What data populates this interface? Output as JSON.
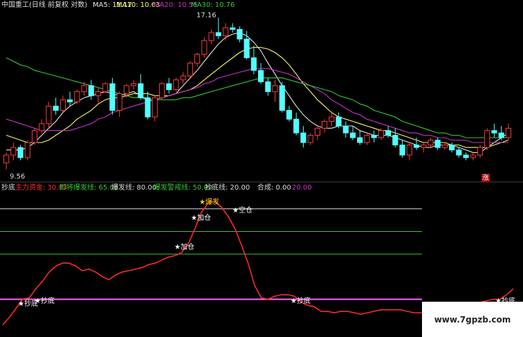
{
  "header": {
    "title": "中国重工(日线 前复权 对数)",
    "ma5": "MA5: 11.17",
    "ma10": "MA10: 10.63",
    "ma20": "MA20: 10.55",
    "ma30": "MA30: 10.76"
  },
  "price_labels": {
    "high": "17.16",
    "low": "9.56",
    "zhang": "涨"
  },
  "sub_header": {
    "name": "抄底",
    "fund": "主力资金: 30.83",
    "about": "即将爆发线: 65.00",
    "burst": "爆发线: 80.00",
    "warn": "爆发警戒线: 50.00",
    "bottom": "抄底线: 20.00",
    "combo": "合成: 0.00",
    "combo_val": "20.00"
  },
  "markers": {
    "bao_fa": "★爆发",
    "kong_cang": "★空仓",
    "jia_cang": "★加仓",
    "chao_di": "★抄底"
  },
  "watermark": "www.7gpzb.com",
  "colors": {
    "up": "#ff3b3b",
    "down": "#54ffff",
    "ma5": "#e8e8e8",
    "ma10": "#ffff66",
    "ma20": "#cc33cc",
    "ma30": "#33cc33",
    "fund_line": "#ff2a2a",
    "level_white": "#dddddd",
    "level_green": "#33cc33",
    "level_purple": "#ff66ff"
  },
  "chart_data": [
    {
      "type": "candlestick",
      "title": "中国重工(日线 前复权 对数)",
      "ylim": [
        9.3,
        17.6
      ],
      "ohlc": [
        [
          9.8,
          10.2,
          9.56,
          10.1
        ],
        [
          10.1,
          10.6,
          9.9,
          10.4
        ],
        [
          10.4,
          10.5,
          9.9,
          10.0
        ],
        [
          10.0,
          10.7,
          9.9,
          10.6
        ],
        [
          10.6,
          11.2,
          10.5,
          11.1
        ],
        [
          11.1,
          11.6,
          11.0,
          11.4
        ],
        [
          11.4,
          12.4,
          11.2,
          12.2
        ],
        [
          12.2,
          12.6,
          11.8,
          12.0
        ],
        [
          12.0,
          12.7,
          11.9,
          12.5
        ],
        [
          12.5,
          12.9,
          12.2,
          12.4
        ],
        [
          12.4,
          13.0,
          12.3,
          12.9
        ],
        [
          12.9,
          13.4,
          12.7,
          13.2
        ],
        [
          13.2,
          13.5,
          12.5,
          12.7
        ],
        [
          12.7,
          13.1,
          12.3,
          12.9
        ],
        [
          12.9,
          13.4,
          12.8,
          13.3
        ],
        [
          13.3,
          13.6,
          11.8,
          12.0
        ],
        [
          12.0,
          12.9,
          11.7,
          12.8
        ],
        [
          12.8,
          13.3,
          12.6,
          13.2
        ],
        [
          13.2,
          13.5,
          13.0,
          13.3
        ],
        [
          13.3,
          13.8,
          12.5,
          12.6
        ],
        [
          12.6,
          12.9,
          11.6,
          11.7
        ],
        [
          11.7,
          12.7,
          11.5,
          12.6
        ],
        [
          12.6,
          13.4,
          12.5,
          13.3
        ],
        [
          13.3,
          13.6,
          12.8,
          13.0
        ],
        [
          13.0,
          13.6,
          12.9,
          13.5
        ],
        [
          13.5,
          13.9,
          13.3,
          13.7
        ],
        [
          13.7,
          14.5,
          13.6,
          14.4
        ],
        [
          14.4,
          15.0,
          14.2,
          14.9
        ],
        [
          14.9,
          15.9,
          14.7,
          15.7
        ],
        [
          15.7,
          16.4,
          15.5,
          16.2
        ],
        [
          16.2,
          17.16,
          15.8,
          16.0
        ],
        [
          16.0,
          16.8,
          15.7,
          16.5
        ],
        [
          16.5,
          16.8,
          16.2,
          16.4
        ],
        [
          16.4,
          16.6,
          15.6,
          15.8
        ],
        [
          15.8,
          16.3,
          14.6,
          14.7
        ],
        [
          14.7,
          15.4,
          13.8,
          14.0
        ],
        [
          14.0,
          14.4,
          13.3,
          13.4
        ],
        [
          13.4,
          13.6,
          12.7,
          12.9
        ],
        [
          12.9,
          13.5,
          12.4,
          13.2
        ],
        [
          13.2,
          13.4,
          11.9,
          12.0
        ],
        [
          12.0,
          12.2,
          11.5,
          11.6
        ],
        [
          11.6,
          11.9,
          10.9,
          11.0
        ],
        [
          11.0,
          11.3,
          10.4,
          10.6
        ],
        [
          10.6,
          11.0,
          10.5,
          10.9
        ],
        [
          10.9,
          11.3,
          10.7,
          11.2
        ],
        [
          11.2,
          11.6,
          11.0,
          11.5
        ],
        [
          11.5,
          11.9,
          11.3,
          11.7
        ],
        [
          11.7,
          11.9,
          11.2,
          11.3
        ],
        [
          11.3,
          11.5,
          10.8,
          11.0
        ],
        [
          11.0,
          11.3,
          10.7,
          10.8
        ],
        [
          10.8,
          11.1,
          10.5,
          10.6
        ],
        [
          10.6,
          11.0,
          10.5,
          10.9
        ],
        [
          10.9,
          11.1,
          10.6,
          10.8
        ],
        [
          10.8,
          11.2,
          10.7,
          11.1
        ],
        [
          11.1,
          11.3,
          10.8,
          10.9
        ],
        [
          10.9,
          11.2,
          10.4,
          10.5
        ],
        [
          10.5,
          10.7,
          10.0,
          10.1
        ],
        [
          10.1,
          10.6,
          9.9,
          10.5
        ],
        [
          10.5,
          10.8,
          10.3,
          10.4
        ],
        [
          10.4,
          10.6,
          10.2,
          10.5
        ],
        [
          10.5,
          10.8,
          10.4,
          10.7
        ],
        [
          10.7,
          10.8,
          10.3,
          10.4
        ],
        [
          10.4,
          10.6,
          10.3,
          10.5
        ],
        [
          10.5,
          10.6,
          10.2,
          10.3
        ],
        [
          10.3,
          10.4,
          10.0,
          10.1
        ],
        [
          10.1,
          10.2,
          9.9,
          10.0
        ],
        [
          10.0,
          10.2,
          9.9,
          10.1
        ],
        [
          10.1,
          10.5,
          10.0,
          10.4
        ],
        [
          10.4,
          11.2,
          10.3,
          11.1
        ],
        [
          11.1,
          11.4,
          10.8,
          11.0
        ],
        [
          11.0,
          11.3,
          10.7,
          10.8
        ],
        [
          10.8,
          11.4,
          10.7,
          11.2
        ]
      ],
      "series": [
        {
          "name": "MA5",
          "values": [
            10.3,
            10.3,
            10.3,
            10.4,
            10.6,
            10.9,
            11.2,
            11.5,
            11.9,
            12.2,
            12.4,
            12.6,
            12.7,
            12.8,
            12.9,
            12.8,
            12.7,
            12.8,
            12.9,
            12.7,
            12.5,
            12.5,
            12.6,
            12.7,
            12.8,
            13.2,
            13.6,
            14.0,
            14.5,
            15.0,
            15.5,
            15.9,
            16.1,
            16.2,
            16.0,
            15.6,
            15.1,
            14.4,
            13.8,
            13.2,
            12.7,
            12.2,
            11.8,
            11.5,
            11.3,
            11.2,
            11.2,
            11.3,
            11.3,
            11.3,
            11.1,
            11.0,
            10.9,
            10.9,
            10.9,
            10.8,
            10.7,
            10.6,
            10.5,
            10.4,
            10.4,
            10.5,
            10.5,
            10.5,
            10.4,
            10.3,
            10.2,
            10.2,
            10.4,
            10.6,
            10.8,
            11.0
          ]
        },
        {
          "name": "MA10",
          "values": [
            10.9,
            10.8,
            10.7,
            10.6,
            10.6,
            10.6,
            10.7,
            10.9,
            11.1,
            11.3,
            11.6,
            11.8,
            12.0,
            12.3,
            12.5,
            12.6,
            12.6,
            12.7,
            12.8,
            12.8,
            12.8,
            12.7,
            12.7,
            12.7,
            12.8,
            12.9,
            13.0,
            13.2,
            13.5,
            13.8,
            14.1,
            14.4,
            14.7,
            15.0,
            15.2,
            15.3,
            15.3,
            15.2,
            15.0,
            14.7,
            14.3,
            13.8,
            13.3,
            12.9,
            12.5,
            12.2,
            11.9,
            11.7,
            11.6,
            11.5,
            11.4,
            11.3,
            11.2,
            11.1,
            11.1,
            11.0,
            10.9,
            10.8,
            10.7,
            10.6,
            10.6,
            10.6,
            10.6,
            10.5,
            10.5,
            10.4,
            10.4,
            10.4,
            10.4,
            10.5,
            10.6,
            10.7
          ]
        },
        {
          "name": "MA20",
          "values": [
            11.6,
            11.5,
            11.4,
            11.3,
            11.2,
            11.1,
            11.1,
            11.1,
            11.1,
            11.1,
            11.2,
            11.3,
            11.4,
            11.6,
            11.7,
            11.9,
            12.0,
            12.1,
            12.2,
            12.3,
            12.4,
            12.5,
            12.6,
            12.7,
            12.8,
            12.9,
            13.0,
            13.1,
            13.3,
            13.4,
            13.6,
            13.7,
            13.8,
            13.9,
            14.0,
            14.1,
            14.1,
            14.1,
            14.0,
            13.9,
            13.8,
            13.6,
            13.4,
            13.2,
            13.0,
            12.8,
            12.5,
            12.3,
            12.1,
            11.9,
            11.8,
            11.6,
            11.5,
            11.4,
            11.3,
            11.2,
            11.1,
            11.0,
            11.0,
            10.9,
            10.9,
            10.8,
            10.8,
            10.7,
            10.7,
            10.7,
            10.6,
            10.6,
            10.6,
            10.6,
            10.6,
            10.6
          ]
        },
        {
          "name": "MA30",
          "values": [
            14.7,
            14.5,
            14.3,
            14.2,
            14.0,
            13.9,
            13.8,
            13.7,
            13.6,
            13.5,
            13.4,
            13.3,
            13.2,
            13.1,
            13.0,
            12.9,
            12.8,
            12.7,
            12.6,
            12.6,
            12.5,
            12.5,
            12.5,
            12.5,
            12.5,
            12.6,
            12.6,
            12.7,
            12.8,
            12.9,
            13.0,
            13.1,
            13.2,
            13.3,
            13.4,
            13.5,
            13.6,
            13.6,
            13.6,
            13.6,
            13.5,
            13.4,
            13.3,
            13.2,
            13.1,
            13.0,
            12.9,
            12.7,
            12.6,
            12.5,
            12.3,
            12.2,
            12.0,
            11.9,
            11.8,
            11.7,
            11.5,
            11.4,
            11.3,
            11.2,
            11.1,
            11.0,
            11.0,
            10.9,
            10.9,
            10.8,
            10.8,
            10.8,
            10.8,
            10.8,
            10.8,
            10.8
          ]
        }
      ]
    },
    {
      "type": "line",
      "title": "抄底",
      "ylim": [
        0,
        90
      ],
      "levels": [
        {
          "name": "爆发线",
          "value": 80
        },
        {
          "name": "即将爆发线",
          "value": 65
        },
        {
          "name": "爆发警戒线",
          "value": 50
        },
        {
          "name": "抄底线",
          "value": 20
        }
      ],
      "series": [
        {
          "name": "主力资金",
          "values": [
            3,
            8,
            14,
            20,
            21,
            27,
            32,
            38,
            42,
            44,
            44,
            42,
            39,
            40,
            38,
            35,
            33,
            36,
            38,
            39,
            40,
            41,
            43,
            44,
            46,
            48,
            49,
            51,
            57,
            67,
            78,
            84,
            85,
            81,
            75,
            67,
            56,
            44,
            29,
            21,
            20,
            22,
            23,
            23,
            22,
            18,
            16,
            15,
            12,
            12,
            11,
            12,
            12,
            11,
            10,
            11,
            12,
            13,
            13,
            13,
            13,
            12,
            11,
            11,
            11,
            11,
            12,
            13,
            14,
            15,
            16,
            17,
            18,
            19,
            20,
            20,
            23,
            27
          ]
        }
      ]
    }
  ]
}
